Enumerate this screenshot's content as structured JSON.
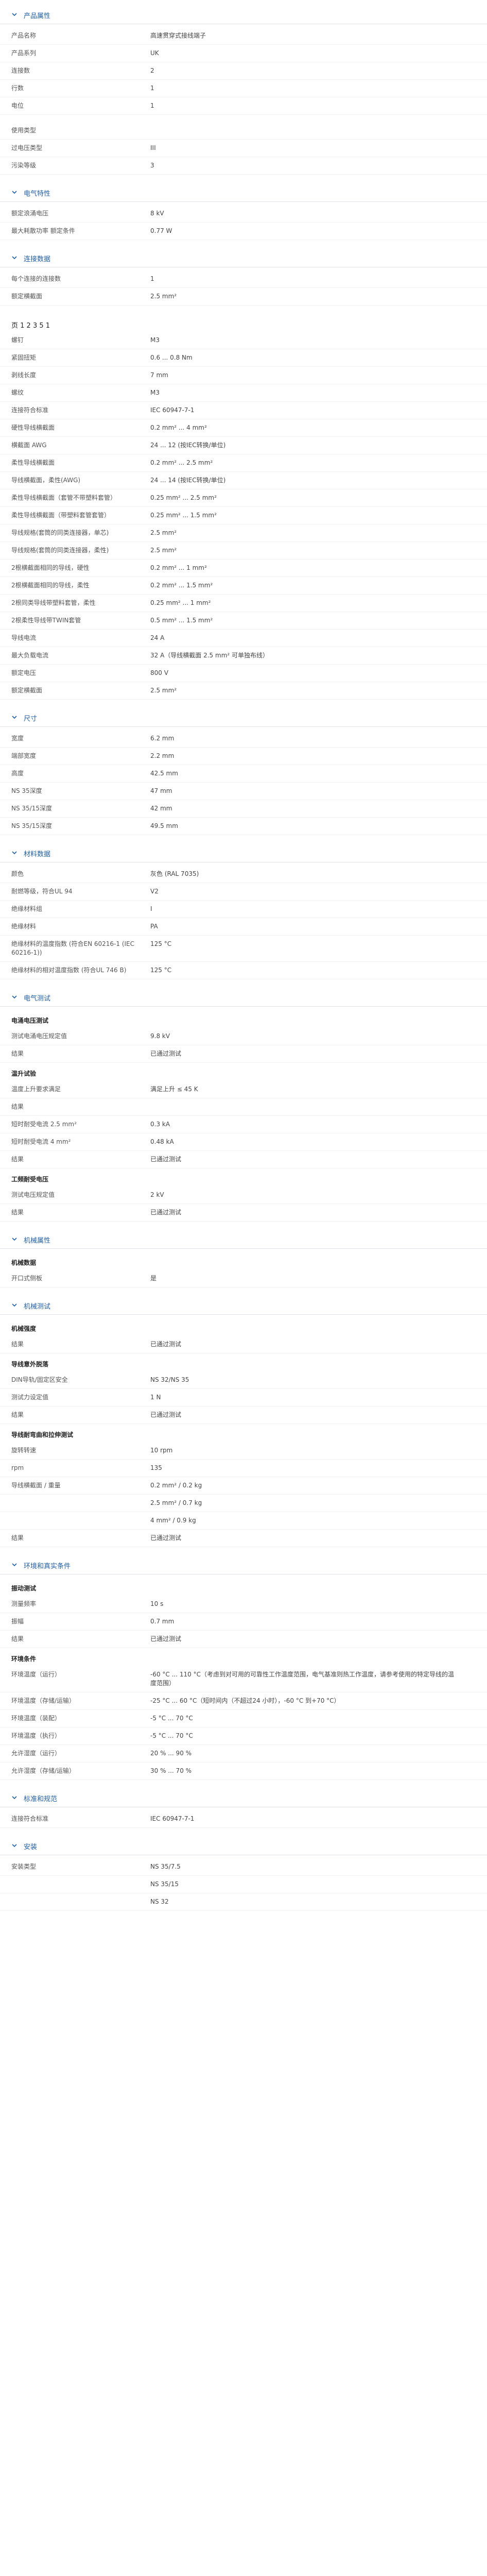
{
  "sections": [
    {
      "id": "general",
      "title": "产品属性",
      "rows": [
        {
          "k": "产品名称",
          "v": "高速贯穿式接线端子"
        },
        {
          "k": "产品系列",
          "v": "UK"
        },
        {
          "k": "连接数",
          "v": "2"
        },
        {
          "k": "行数",
          "v": "1"
        },
        {
          "k": "电位",
          "v": "1"
        },
        {
          "gap": true
        },
        {
          "k": "使用类型",
          "v": ""
        },
        {
          "k": "过电压类型",
          "v": "III"
        },
        {
          "k": "污染等级",
          "v": "3"
        }
      ]
    },
    {
      "id": "electrical",
      "title": "电气特性",
      "rows": [
        {
          "k": "额定浪涌电压",
          "v": "8 kV"
        },
        {
          "k": "最大耗散功率 额定条件",
          "v": "0.77 W"
        }
      ]
    },
    {
      "id": "connection",
      "title": "连接数据",
      "rows": [
        {
          "k": "每个连接的连接数",
          "v": "1"
        },
        {
          "k": "额定横截面",
          "v": "2.5 mm²"
        }
      ]
    }
  ],
  "page_indicator": "页 1 2 3 5 1",
  "connection_rows": [
    {
      "k": "螺钉",
      "v": "M3"
    },
    {
      "k": "紧固扭矩",
      "v": "0.6 ... 0.8 Nm"
    },
    {
      "k": "剥线长度",
      "v": "7 mm"
    },
    {
      "k": "螺纹",
      "v": "M3"
    },
    {
      "k": "连接符合标准",
      "v": "IEC 60947-7-1"
    },
    {
      "k": "硬性导线横截面",
      "v": "0.2 mm² ... 4 mm²"
    },
    {
      "k": "横截面 AWG",
      "v": "24 ... 12 (按IEC转换/单位)"
    },
    {
      "k": "柔性导线横截面",
      "v": "0.2 mm² ... 2.5 mm²"
    },
    {
      "k": "导线横截面，柔性(AWG)",
      "v": "24 ... 14 (按IEC转换/单位)"
    },
    {
      "k": "柔性导线横截面（套管不带塑料套管）",
      "v": "0.25 mm² ... 2.5 mm²"
    },
    {
      "k": "柔性导线横截面（带塑料套管套管）",
      "v": "0.25 mm² ... 1.5 mm²"
    },
    {
      "k": "导线规格(套筒的同类连接器，单芯)",
      "v": "2.5 mm²"
    },
    {
      "k": "导线规格(套筒的同类连接器，柔性)",
      "v": "2.5 mm²"
    },
    {
      "k": "2根横截面相同的导线，硬性",
      "v": "0.2 mm² ... 1 mm²"
    },
    {
      "k": "2根横截面相同的导线，柔性",
      "v": "0.2 mm² ... 1.5 mm²"
    },
    {
      "k": "2根同类导线带塑料套管，柔性",
      "v": "0.25 mm² ... 1 mm²"
    },
    {
      "k": "2根柔性导线带TWIN套管",
      "v": "0.5 mm² ... 1.5 mm²"
    },
    {
      "k": "导线电流",
      "v": "24 A"
    },
    {
      "k": "最大负载电流",
      "v": "32 A（导线横截面 2.5 mm² 可单独布线）"
    },
    {
      "k": "额定电压",
      "v": "800 V"
    },
    {
      "k": "额定横截面",
      "v": "2.5 mm²"
    }
  ],
  "dimensions": {
    "title": "尺寸",
    "rows": [
      {
        "k": "宽度",
        "v": "6.2 mm"
      },
      {
        "k": "端部宽度",
        "v": "2.2 mm"
      },
      {
        "k": "高度",
        "v": "42.5 mm"
      },
      {
        "k": "NS 35深度",
        "v": "47 mm"
      },
      {
        "k": "NS 35/15深度",
        "v": "42 mm"
      },
      {
        "k": "NS 35/15深度",
        "v": "49.5 mm"
      }
    ]
  },
  "material": {
    "title": "材料数据",
    "rows": [
      {
        "k": "颜色",
        "v": "灰色 (RAL 7035)"
      },
      {
        "k": "耐燃等级，符合UL 94",
        "v": "V2"
      },
      {
        "k": "绝缘材料组",
        "v": "I"
      },
      {
        "k": "绝缘材料",
        "v": "PA"
      },
      {
        "k": "绝缘材料的温度指数 (符合EN 60216-1 (IEC 60216-1))",
        "v": "125 °C"
      },
      {
        "k": "绝缘材料的相对温度指数 (符合UL 746 B)",
        "v": "125 °C"
      }
    ]
  },
  "electrical_tests": {
    "title": "电气测试",
    "groups": [
      {
        "sub": "电涌电压测试",
        "rows": [
          {
            "k": "测试电涌电压规定值",
            "v": "9.8 kV"
          },
          {
            "k": "结果",
            "v": "已通过测试"
          }
        ]
      },
      {
        "sub": "温升试验",
        "rows": [
          {
            "k": "温度上升要求满足",
            "v": "满足上升 ≤ 45 K"
          },
          {
            "k": "结果",
            "v": ""
          },
          {
            "k": "短时耐受电流 2.5 mm²",
            "v": "0.3 kA"
          },
          {
            "k": "短时耐受电流 4 mm²",
            "v": "0.48 kA"
          },
          {
            "k": "结果",
            "v": "已通过测试"
          }
        ]
      },
      {
        "sub": "工频耐受电压",
        "rows": [
          {
            "k": "测试电压规定值",
            "v": "2 kV"
          },
          {
            "k": "结果",
            "v": "已通过测试"
          }
        ]
      }
    ]
  },
  "mechanical": {
    "title": "机械属性",
    "groups": [
      {
        "sub": "机械数据",
        "rows": [
          {
            "k": "开口式侧板",
            "v": "是"
          }
        ]
      }
    ]
  },
  "mech_tests": {
    "title": "机械测试",
    "groups": [
      {
        "sub": "机械强度",
        "rows": [
          {
            "k": "结果",
            "v": "已通过测试"
          }
        ]
      },
      {
        "sub": "导线意外脱落",
        "rows": [
          {
            "k": "DIN导轨/固定区安全",
            "v": "NS 32/NS 35"
          },
          {
            "k": "测试力设定值",
            "v": "1 N"
          },
          {
            "k": "结果",
            "v": "已通过测试"
          }
        ]
      },
      {
        "sub": "导线耐弯曲和拉伸测试",
        "rows": [
          {
            "k": "旋转转速",
            "v": "10 rpm"
          },
          {
            "k": "rpm",
            "v": "135"
          },
          {
            "k": "导线横截面 / 重量",
            "v": "0.2 mm² / 0.2 kg"
          },
          {
            "k": "",
            "v": "2.5 mm² / 0.7 kg"
          },
          {
            "k": "",
            "v": "4 mm² / 0.9 kg"
          },
          {
            "k": "结果",
            "v": "已通过测试"
          }
        ]
      }
    ]
  },
  "env": {
    "title": "环境和真实条件",
    "groups": [
      {
        "sub": "振动测试",
        "rows": [
          {
            "k": "测量频率",
            "v": "10 s"
          },
          {
            "k": "振幅",
            "v": "0.7 mm"
          },
          {
            "k": "结果",
            "v": "已通过测试"
          }
        ]
      },
      {
        "sub": "环境条件",
        "rows": [
          {
            "k": "环境温度（运行）",
            "v": "-60 °C ... 110 °C（考虑到对可用的可靠性工作温度范围，电气基准则热工作温度，请参考使用的特定导线的温度范围）"
          },
          {
            "k": "环境温度（存储/运输）",
            "v": "-25 °C ... 60 °C（短时间内（不超过24 小时），-60 °C 到+70 °C）"
          },
          {
            "k": "环境温度（装配）",
            "v": "-5 °C ... 70 °C"
          },
          {
            "k": "环境温度（执行）",
            "v": "-5 °C ... 70 °C"
          },
          {
            "k": "允许湿度（运行）",
            "v": "20 % ... 90 %"
          },
          {
            "k": "允许湿度（存储/运输）",
            "v": "30 % ... 70 %"
          }
        ]
      }
    ]
  },
  "standards": {
    "title": "标准和规范",
    "rows": [
      {
        "k": "连接符合标准",
        "v": "IEC 60947-7-1"
      }
    ]
  },
  "mounting": {
    "title": "安装",
    "rows": [
      {
        "k": "安装类型",
        "v": "NS 35/7.5"
      },
      {
        "k": "",
        "v": "NS 35/15"
      },
      {
        "k": "",
        "v": "NS 32"
      }
    ]
  },
  "colors": {
    "accent": "#1f5fa8",
    "row_border": "#f0f2f4"
  }
}
